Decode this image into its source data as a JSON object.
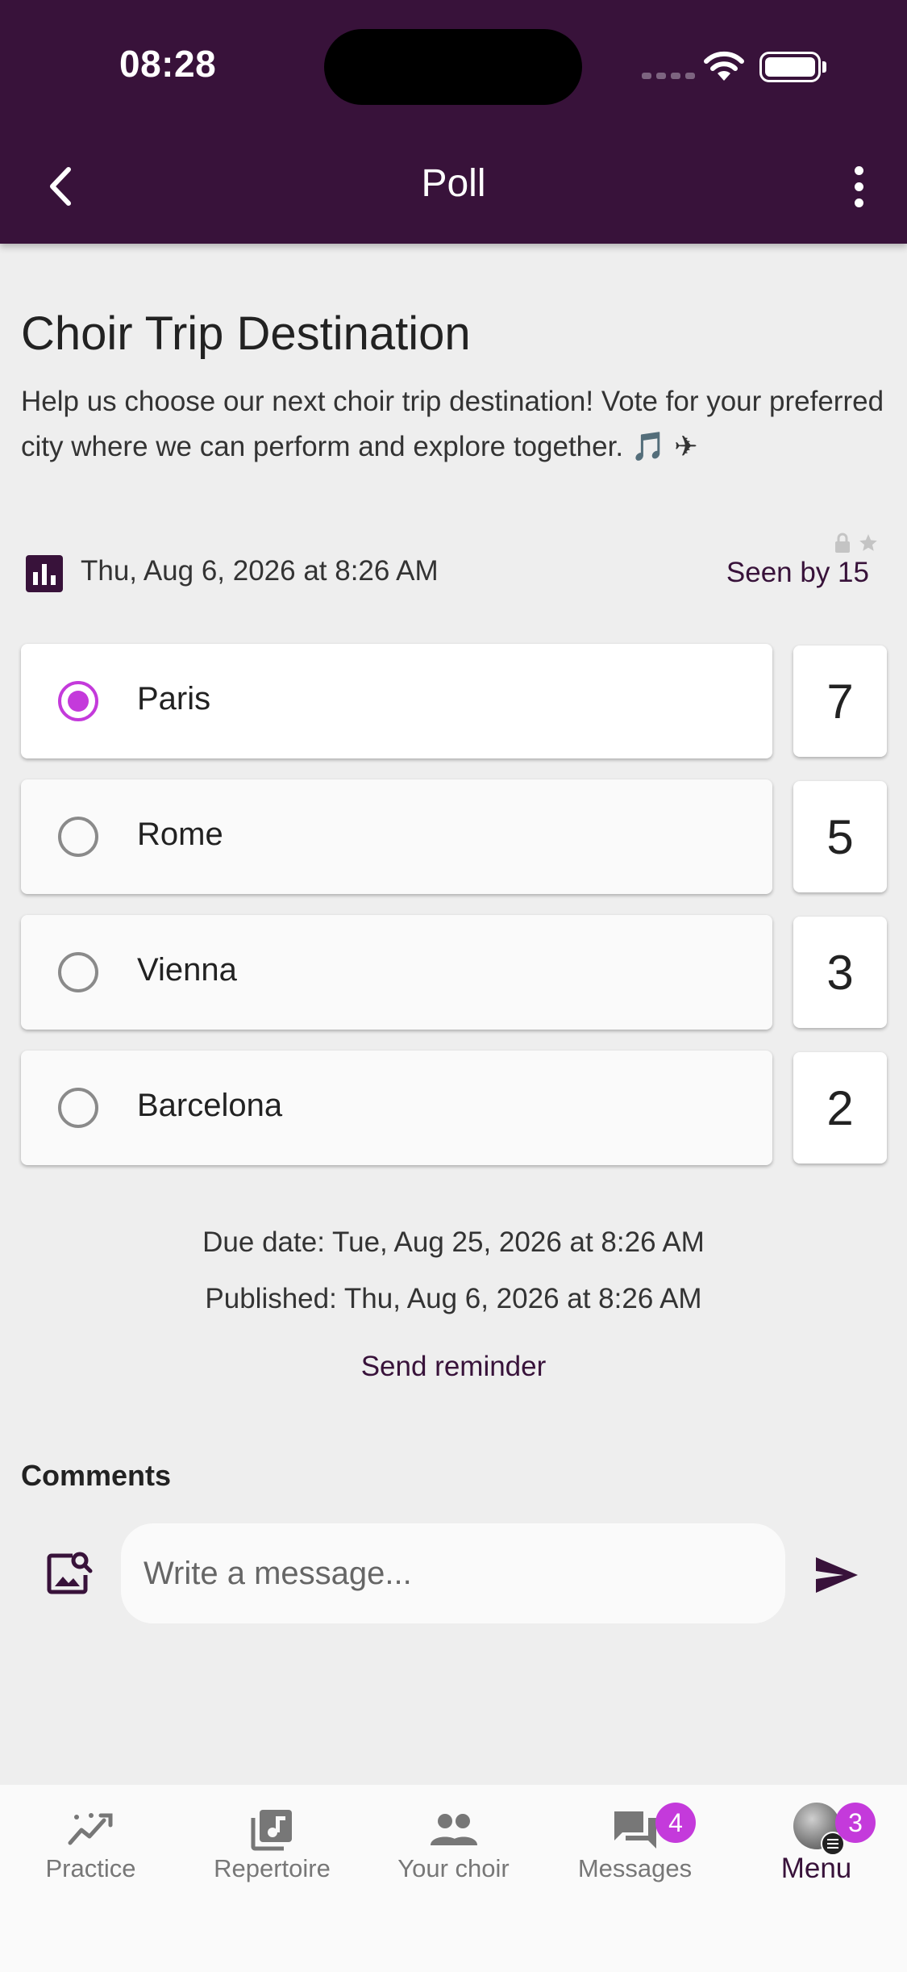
{
  "status": {
    "time": "08:28"
  },
  "header": {
    "title": "Poll"
  },
  "poll": {
    "title": "Choir Trip Destination",
    "description": "Help us choose our next choir trip destination! Vote for your preferred city where we can perform and explore together. 🎵 ✈",
    "date": "Thu, Aug 6, 2026 at 8:26 AM",
    "seen_by": "Seen by 15",
    "options": [
      {
        "label": "Paris",
        "count": "7",
        "selected": true
      },
      {
        "label": "Rome",
        "count": "5",
        "selected": false
      },
      {
        "label": "Vienna",
        "count": "3",
        "selected": false
      },
      {
        "label": "Barcelona",
        "count": "2",
        "selected": false
      }
    ],
    "due_date": "Due date: Tue, Aug 25, 2026 at 8:26 AM",
    "published": "Published: Thu, Aug 6, 2026 at 8:26 AM",
    "send_reminder": "Send reminder"
  },
  "comments": {
    "heading": "Comments",
    "placeholder": "Write a message..."
  },
  "nav": {
    "items": [
      {
        "label": "Practice",
        "icon": "practice-chart-icon"
      },
      {
        "label": "Repertoire",
        "icon": "music-library-icon"
      },
      {
        "label": "Your choir",
        "icon": "people-icon"
      },
      {
        "label": "Messages",
        "icon": "messages-icon",
        "badge": "4"
      },
      {
        "label": "Menu",
        "icon": "avatar",
        "badge": "3"
      }
    ]
  },
  "colors": {
    "brand": "#38123a",
    "accent": "#c43adb",
    "background": "#eeeeee"
  }
}
